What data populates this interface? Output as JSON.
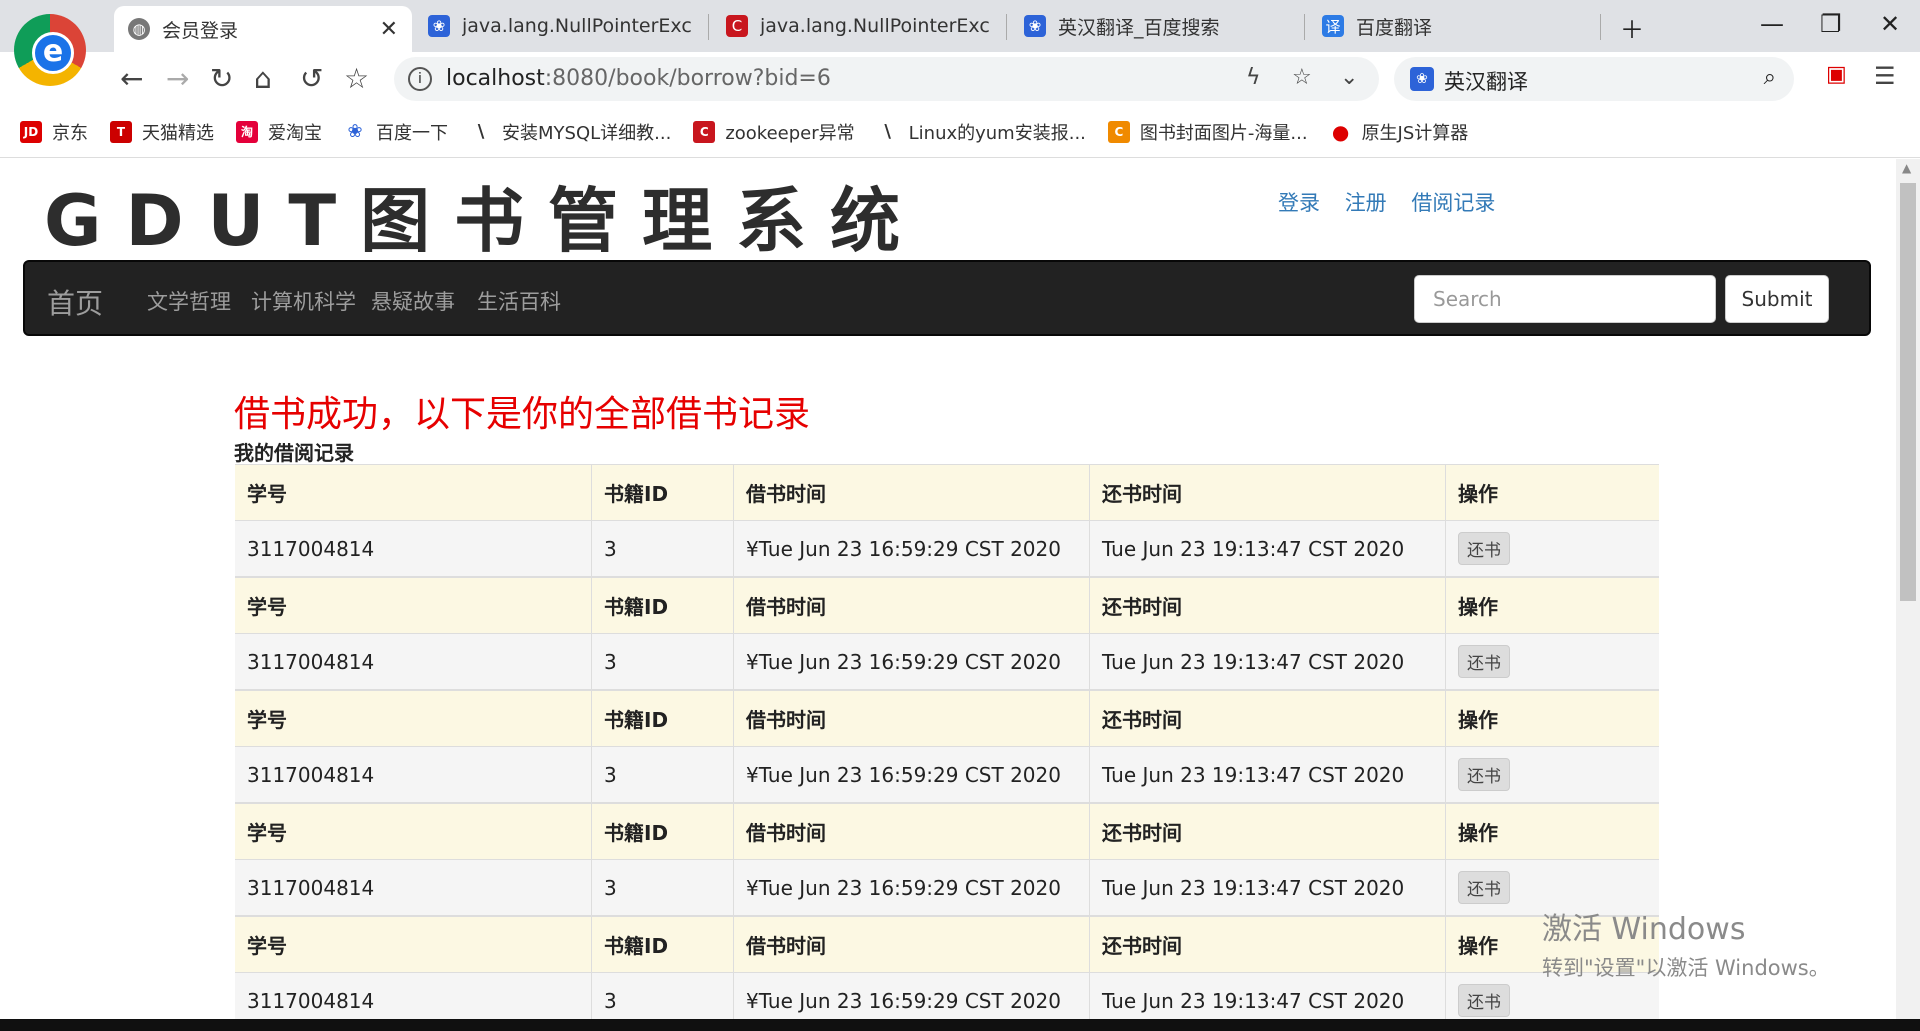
{
  "tabs": [
    {
      "title": "会员登录",
      "icon": "globe-icon"
    },
    {
      "title": "java.lang.NullPointerExcept",
      "icon": "baidu-paw-icon"
    },
    {
      "title": "java.lang.NullPointerExcep",
      "icon": "csdn-icon"
    },
    {
      "title": "英汉翻译_百度搜索",
      "icon": "baidu-paw-icon"
    },
    {
      "title": "百度翻译",
      "icon": "baidu-translate-icon"
    }
  ],
  "address": {
    "host": "localhost",
    "path": ":8080/book/borrow?bid=6"
  },
  "search_engine": {
    "text": "英汉翻译"
  },
  "bookmarks": [
    {
      "label": "京东",
      "badge": "JD"
    },
    {
      "label": "天猫精选",
      "badge": "T"
    },
    {
      "label": "爱淘宝",
      "badge": "淘"
    },
    {
      "label": "百度一下",
      "badge": "❀"
    },
    {
      "label": "安装MYSQL详细教...",
      "badge": "\\"
    },
    {
      "label": "zookeeper异常",
      "badge": "C"
    },
    {
      "label": "Linux的yum安装报...",
      "badge": "\\"
    },
    {
      "label": "图书封面图片-海量...",
      "badge": "C"
    },
    {
      "label": "原生JS计算器",
      "badge": "●"
    }
  ],
  "site": {
    "title": "GDUT图书管理系统",
    "links": {
      "login": "登录",
      "register": "注册",
      "records": "借阅记录"
    },
    "nav": {
      "brand": "首页",
      "items": [
        "文学哲理",
        "计算机科学",
        "悬疑故事",
        "生活百科"
      ]
    },
    "search": {
      "placeholder": "Search",
      "button": "Submit"
    }
  },
  "message": "借书成功，以下是你的全部借书记录",
  "subtitle": "我的借阅记录",
  "table": {
    "headers": [
      "学号",
      "书籍ID",
      "借书时间",
      "还书时间",
      "操作"
    ],
    "records": [
      {
        "student_id": "3117004814",
        "book_id": "3",
        "borrow_time": "¥Tue Jun 23 16:59:29 CST 2020",
        "return_time": "Tue Jun 23 19:13:47 CST 2020",
        "action": "还书"
      },
      {
        "student_id": "3117004814",
        "book_id": "3",
        "borrow_time": "¥Tue Jun 23 16:59:29 CST 2020",
        "return_time": "Tue Jun 23 19:13:47 CST 2020",
        "action": "还书"
      },
      {
        "student_id": "3117004814",
        "book_id": "3",
        "borrow_time": "¥Tue Jun 23 16:59:29 CST 2020",
        "return_time": "Tue Jun 23 19:13:47 CST 2020",
        "action": "还书"
      },
      {
        "student_id": "3117004814",
        "book_id": "3",
        "borrow_time": "¥Tue Jun 23 16:59:29 CST 2020",
        "return_time": "Tue Jun 23 19:13:47 CST 2020",
        "action": "还书"
      },
      {
        "student_id": "3117004814",
        "book_id": "3",
        "borrow_time": "¥Tue Jun 23 16:59:29 CST 2020",
        "return_time": "Tue Jun 23 19:13:47 CST 2020",
        "action": "还书"
      }
    ]
  },
  "watermark": {
    "line1": "激活 Windows",
    "line2": "转到\"设置\"以激活 Windows。"
  },
  "colors": {
    "message": "#e60000",
    "link": "#337ab7",
    "navbar": "#222222",
    "header_row": "#fcf8e3"
  }
}
